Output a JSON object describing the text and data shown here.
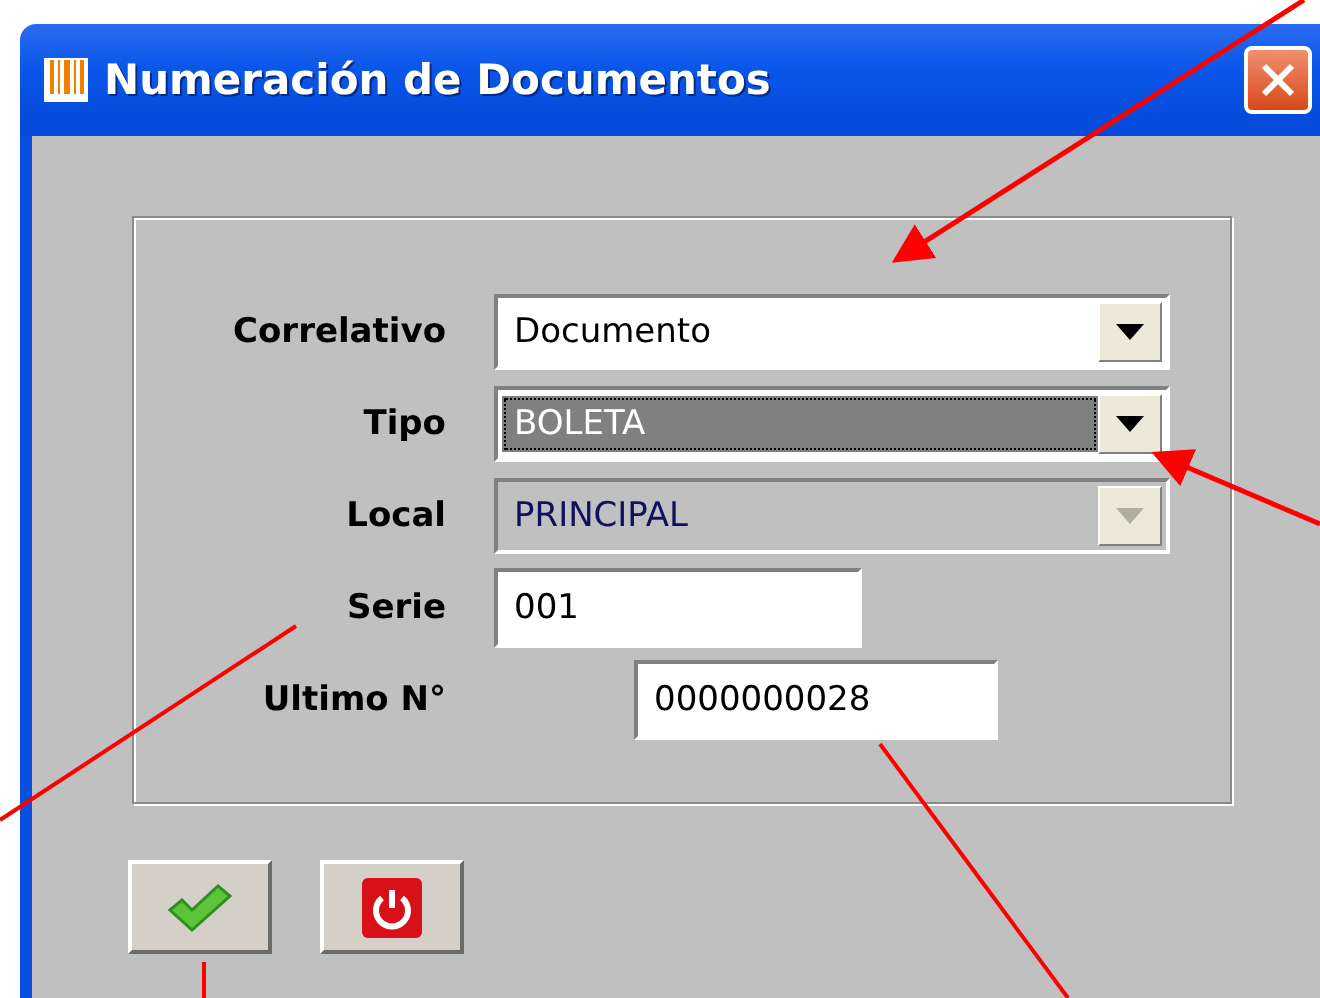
{
  "window": {
    "title": "Numeración de Documentos"
  },
  "fields": [
    {
      "label": "Correlativo",
      "kind": "combo",
      "value": "Documento",
      "focused": false,
      "disabled": false
    },
    {
      "label": "Tipo",
      "kind": "combo",
      "value": "BOLETA",
      "focused": true,
      "disabled": false
    },
    {
      "label": "Local",
      "kind": "combo",
      "value": "PRINCIPAL",
      "focused": false,
      "disabled": true
    },
    {
      "label": "Serie",
      "kind": "text",
      "value": "001",
      "focused": false,
      "disabled": false
    },
    {
      "label": "Ultimo N°",
      "kind": "text",
      "value": "0000000028",
      "focused": false,
      "disabled": false
    }
  ],
  "buttons": [
    {
      "kind": "accept"
    },
    {
      "kind": "power"
    }
  ]
}
